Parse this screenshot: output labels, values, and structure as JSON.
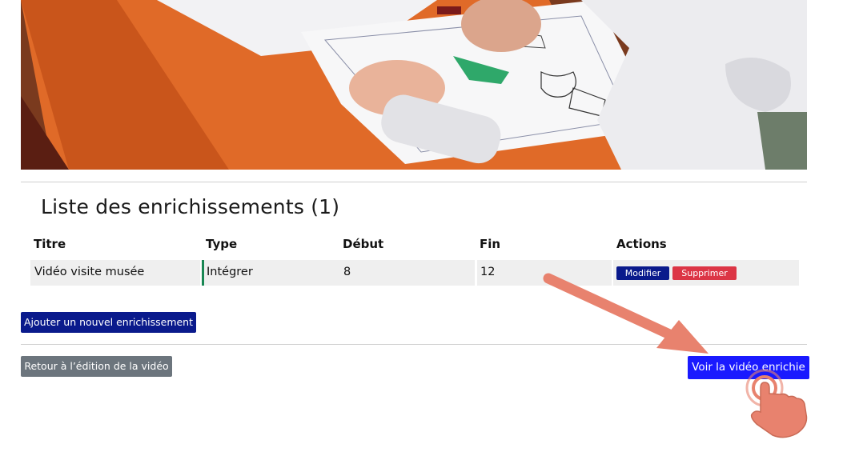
{
  "enrichments": {
    "title": "Liste des enrichissements (1)",
    "columns": [
      "Titre",
      "Type",
      "Début",
      "Fin",
      "Actions"
    ],
    "rows": [
      {
        "titre": "Vidéo visite musée",
        "type": "Intégrer",
        "debut": "8",
        "fin": "12",
        "modify_label": "Modifier",
        "delete_label": "Supprimer"
      }
    ]
  },
  "buttons": {
    "add_label": "Ajouter un nouvel enrichissement",
    "back_label": "Retour à l’édition de la vidéo",
    "view_label": "Voir la vidéo enrichie"
  },
  "colors": {
    "primary_dark": "#0a1a8c",
    "primary_bright": "#1a1aff",
    "danger": "#dc3545",
    "secondary": "#6c757d",
    "annotation": "#e8826e"
  }
}
